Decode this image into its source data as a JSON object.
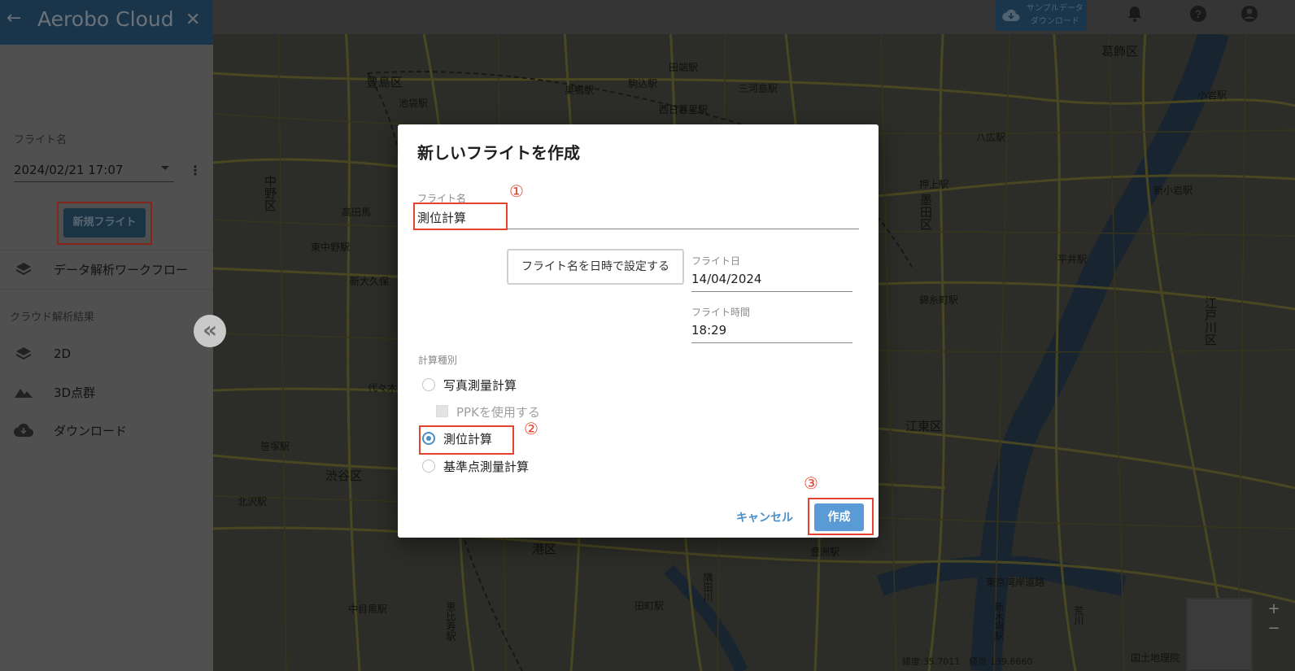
{
  "app": {
    "title": "Aerobo Cloud"
  },
  "topbar": {
    "sample_line1": "サンプルデータ",
    "sample_line2": "ダウンロード",
    "icons": [
      "cloud-download-icon",
      "bell-icon",
      "help-icon",
      "account-icon"
    ]
  },
  "sidebar": {
    "flight_name_label": "フライト名",
    "flight_name_value": "2024/02/21 17:07",
    "new_flight_label": "新規フライト",
    "workflow_label": "データ解析ワークフロー",
    "cloud_results_label": "クラウド解析結果",
    "items": [
      {
        "label": "2D",
        "icon": "layers-icon"
      },
      {
        "label": "3D点群",
        "icon": "terrain-icon"
      },
      {
        "label": "ダウンロード",
        "icon": "cloud-download-icon"
      }
    ]
  },
  "dialog": {
    "title": "新しいフライトを作成",
    "flight_name_label": "フライト名",
    "flight_name_value": "測位計算",
    "set_name_button": "フライト名を日時で設定する",
    "flight_date_label": "フライト日",
    "flight_date_value": "14/04/2024",
    "flight_time_label": "フライト時間",
    "flight_time_value": "18:29",
    "calc_type_label": "計算種別",
    "options": [
      {
        "label": "写真測量計算",
        "selected": false
      },
      {
        "label": "測位計算",
        "selected": true
      },
      {
        "label": "基準点測量計算",
        "selected": false
      }
    ],
    "ppk_label": "PPKを使用する",
    "cancel_label": "キャンセル",
    "create_label": "作成"
  },
  "annotations": {
    "step1": "①",
    "step2": "②",
    "step3": "③"
  },
  "map": {
    "labels": {
      "toshima": "豊島区",
      "katsushika": "葛飾区",
      "nakano": "中野区",
      "sumida": "墨田区",
      "edogawa": "江戸川区",
      "shibuya": "渋谷区",
      "koto": "江東区",
      "minato": "港区",
      "ikebukuro": "池袋駅",
      "tabata": "田端駅",
      "mikawashima": "三河島駅",
      "higashi_nakano": "東中野駅",
      "takadanobaba": "高田馬",
      "sasazuka": "笹塚駅",
      "kitazawa": "北沢駅",
      "nakameguro": "中目黒駅",
      "shin_koiwa": "新小岩駅",
      "hirai": "平井駅",
      "kinshicho": "錦糸町駅",
      "oshiage": "押上駅",
      "koiwa": "小岩駅",
      "hachiko": "八広駅",
      "tokyo_wangan": "東京湾岸道路",
      "shin_kiba": "新木場駅",
      "toyosu": "豊洲駅",
      "komagome": "駒込駅",
      "sugamo": "巣鴨駅",
      "nishi_nippori": "西日暮里駅",
      "ebisu": "恵比寿駅",
      "arakawa": "荒川",
      "shin_okubo": "新大久保",
      "yoyogi": "代々木",
      "tamachi": "田町駅",
      "sumidagawa": "隅田川",
      "gsi": "国土地理院"
    },
    "coords": "緯度:35.7011　経度:139.6660"
  }
}
